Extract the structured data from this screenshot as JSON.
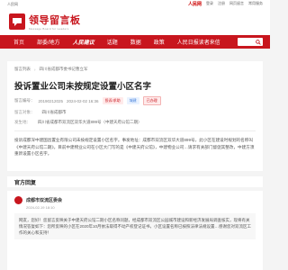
{
  "topbar": {
    "left": "人民网",
    "rm_logo": "人民网",
    "links": [
      "登录",
      "注册",
      "网页留言",
      "常用服务"
    ]
  },
  "header": {
    "logo_title": "领导留言板",
    "logo_subtitle": "Message Board for Leaders"
  },
  "nav": {
    "items": [
      "首页",
      "部委/地方",
      "人民建议",
      "话题",
      "数据",
      "政策",
      "人民日报读者来信"
    ]
  },
  "breadcrumb": [
    "留言列表",
    "四川省成都市委书记曹立军"
  ],
  "message": {
    "title": "投诉置业公司未按规定设置小区名字",
    "id_label": "留言编号：",
    "id_value": "20190212025",
    "date": "2024-02-02 16:36",
    "tags": [
      "投诉/求助",
      "城建",
      "已办理"
    ],
    "row1_label": "留言对象：",
    "row1_value": "四川省成都市",
    "row2_label": "发生地：",
    "row2_value": "四川省成都市双流区双华大道899号（中建天府公馆二期）",
    "body": "投诉成都深中建国昌置业有限公司未按规定设置小区名字。事发地址：成都市双流区双华大道899号，此小区在建设时规划的名称叫《中建天府公馆二期》。目前中建物业公司在小区大门写的是《中建天府公馆》，中建物业公司…请求有关部门督促其整改，中建方须重新设置小区名字。"
  },
  "official_reply_label": "官方回复",
  "reply": {
    "org": "成都市双流区委会",
    "date": "2024-02-19 18:10",
    "body": "网友，您好！您留言反映关于中建天府公馆二期小区名称问题，经成都市双流区公园城市建设和新经济发展局调查核实，现将有关情况答复如下：您所反映的小区在2020年10月依法取得不动产权登记证书，小区设置名称已按照法律法规设置…感谢您对双流区工作的关心和支持！"
  }
}
